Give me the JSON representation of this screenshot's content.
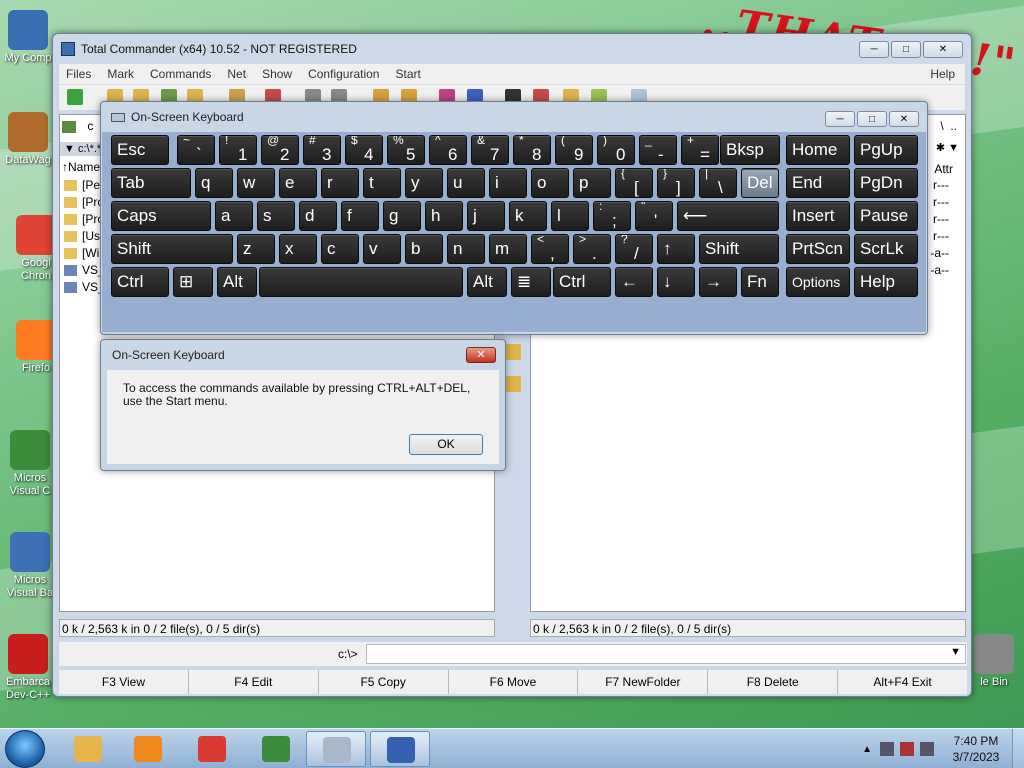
{
  "desktop": {
    "banner": "..THAT ...!!\"",
    "icons": [
      {
        "label": "My Comp",
        "color": "#3a6fb4"
      },
      {
        "label": "DataWag",
        "color": "#b06a2c"
      },
      {
        "label": "Googl Chron",
        "color": "#e04436"
      },
      {
        "label": "Firefo",
        "color": "#ff7b22"
      },
      {
        "label": "Micros Visual C",
        "color": "#3c8c3c"
      },
      {
        "label": "Micros Visual Ba",
        "color": "#3f6fb4"
      },
      {
        "label": "Embarca Dev-C++",
        "color": "#c81e1e"
      },
      {
        "label": "le Bin",
        "color": "#888888"
      }
    ]
  },
  "commander": {
    "title": "Total Commander (x64) 10.52 - NOT REGISTERED",
    "menu": [
      "Files",
      "Mark",
      "Commands",
      "Net",
      "Show",
      "Configuration",
      "Start",
      "Help"
    ],
    "left_panel": {
      "drive": "c",
      "path": "c:\\*.*",
      "column": "↑Name",
      "files": [
        "[Per",
        "[Pro",
        "[Pro",
        "[Use",
        "[Wi",
        "VS_I",
        "VS_I"
      ],
      "status": "0 k / 2,563 k in 0 / 2 file(s), 0 / 5 dir(s)"
    },
    "right_panel": {
      "column": "Attr",
      "attrs": [
        "r---",
        "r---",
        "r---",
        "r---",
        "-a--",
        "-a--"
      ],
      "status": "0 k / 2,563 k in 0 / 2 file(s), 0 / 5 dir(s)"
    },
    "cmd_prompt": "c:\\>",
    "fkeys": [
      "F3 View",
      "F4 Edit",
      "F5 Copy",
      "F6 Move",
      "F7 NewFolder",
      "F8 Delete",
      "Alt+F4 Exit"
    ]
  },
  "osk": {
    "title": "On-Screen Keyboard",
    "keys": [
      {
        "label": "Esc"
      },
      {
        "shift": "~",
        "main": "`"
      },
      {
        "shift": "!",
        "main": "1"
      },
      {
        "shift": "@",
        "main": "2"
      },
      {
        "shift": "#",
        "main": "3"
      },
      {
        "shift": "$",
        "main": "4"
      },
      {
        "shift": "%",
        "main": "5"
      },
      {
        "shift": "^",
        "main": "6"
      },
      {
        "shift": "&",
        "main": "7"
      },
      {
        "shift": "*",
        "main": "8"
      },
      {
        "shift": "(",
        "main": "9"
      },
      {
        "shift": ")",
        "main": "0"
      },
      {
        "shift": "_",
        "main": "-"
      },
      {
        "shift": "+",
        "main": "="
      },
      {
        "label": "Bksp"
      },
      {
        "label": "Home"
      },
      {
        "label": "PgUp"
      },
      {
        "label": "Tab"
      },
      {
        "label": "q"
      },
      {
        "label": "w"
      },
      {
        "label": "e"
      },
      {
        "label": "r"
      },
      {
        "label": "t"
      },
      {
        "label": "y"
      },
      {
        "label": "u"
      },
      {
        "label": "i"
      },
      {
        "label": "o"
      },
      {
        "label": "p"
      },
      {
        "shift": "{",
        "main": "["
      },
      {
        "shift": "}",
        "main": "]"
      },
      {
        "shift": "|",
        "main": "\\"
      },
      {
        "label": "Del"
      },
      {
        "label": "End"
      },
      {
        "label": "PgDn"
      },
      {
        "label": "Caps"
      },
      {
        "label": "a"
      },
      {
        "label": "s"
      },
      {
        "label": "d"
      },
      {
        "label": "f"
      },
      {
        "label": "g"
      },
      {
        "label": "h"
      },
      {
        "label": "j"
      },
      {
        "label": "k"
      },
      {
        "label": "l"
      },
      {
        "shift": ":",
        "main": ";"
      },
      {
        "shift": "\"",
        "main": "'"
      },
      {
        "label": "⟵"
      },
      {
        "label": "Insert"
      },
      {
        "label": "Pause"
      },
      {
        "label": "Shift"
      },
      {
        "label": "z"
      },
      {
        "label": "x"
      },
      {
        "label": "c"
      },
      {
        "label": "v"
      },
      {
        "label": "b"
      },
      {
        "label": "n"
      },
      {
        "label": "m"
      },
      {
        "shift": "<",
        "main": ","
      },
      {
        "shift": ">",
        "main": "."
      },
      {
        "shift": "?",
        "main": "/"
      },
      {
        "label": "↑"
      },
      {
        "label": "Shift"
      },
      {
        "label": "PrtScn"
      },
      {
        "label": "ScrLk"
      },
      {
        "label": "Ctrl"
      },
      {
        "label": "⊞"
      },
      {
        "label": "Alt"
      },
      {
        "label": ""
      },
      {
        "label": "Alt"
      },
      {
        "label": "≣"
      },
      {
        "label": "Ctrl"
      },
      {
        "label": "←"
      },
      {
        "label": "↓"
      },
      {
        "label": "→"
      },
      {
        "label": "Fn"
      },
      {
        "label": "Options"
      },
      {
        "label": "Help"
      }
    ]
  },
  "dialog": {
    "title": "On-Screen Keyboard",
    "message": "To access the commands available by pressing CTRL+ALT+DEL, use the Start menu.",
    "ok": "OK"
  },
  "taskbar": {
    "apps": [
      {
        "name": "explorer",
        "color": "#e3b54a"
      },
      {
        "name": "media-player",
        "color": "#f08a1c"
      },
      {
        "name": "chrome",
        "color": "#d93b30"
      },
      {
        "name": "csharp",
        "color": "#3c8c3c"
      },
      {
        "name": "on-screen-keyboard",
        "color": "#a8b8c8"
      },
      {
        "name": "total-commander",
        "color": "#3462b0"
      }
    ],
    "time": "7:40 PM",
    "date": "3/7/2023"
  }
}
